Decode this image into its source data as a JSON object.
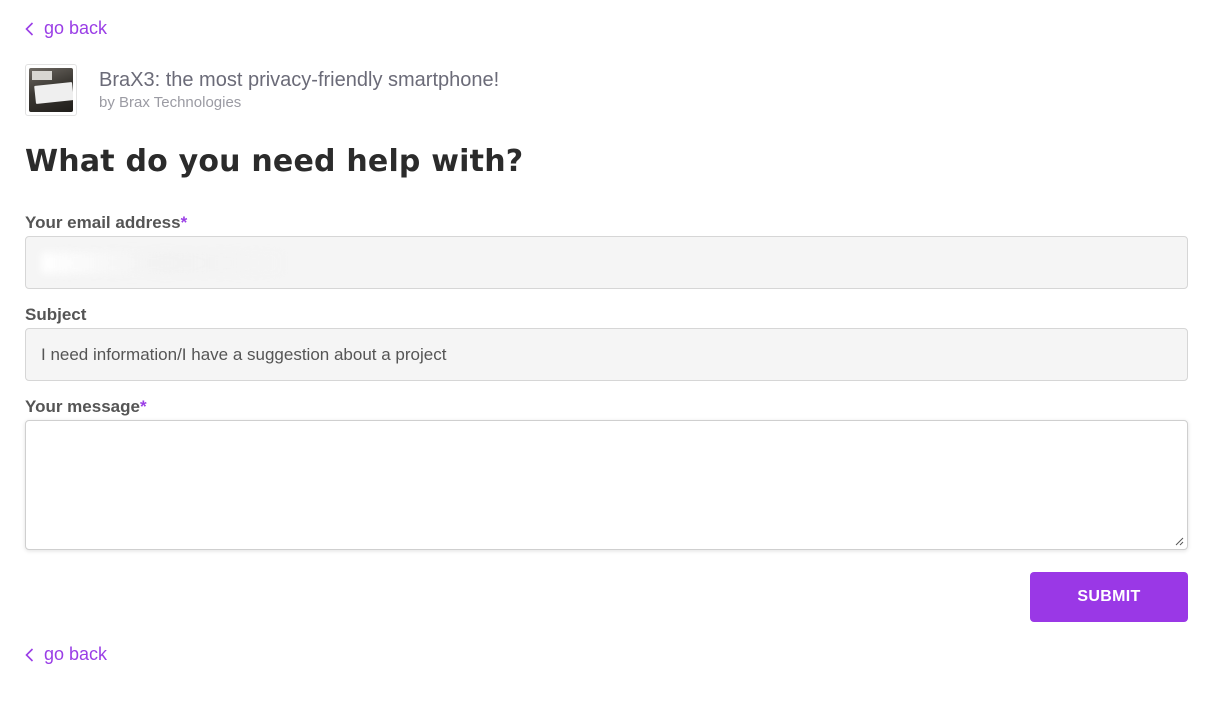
{
  "nav": {
    "go_back_label": "go back",
    "go_back_icon": "chevron-left-icon"
  },
  "project": {
    "title": "BraX3: the most privacy-friendly smartphone!",
    "author": "by Brax Technologies"
  },
  "form": {
    "heading": "What do you need help with?",
    "email_label": "Your email address",
    "required_marker": "*",
    "email_value": "",
    "subject_label": "Subject",
    "subject_value": "I need information/I have a suggestion about a project",
    "message_label": "Your message",
    "message_value": "",
    "submit_label": "SUBMIT"
  },
  "colors": {
    "accent": "#9a38e6",
    "link": "#9a3ee6",
    "input_bg": "#f5f5f5",
    "heading": "#2b2b2b"
  }
}
